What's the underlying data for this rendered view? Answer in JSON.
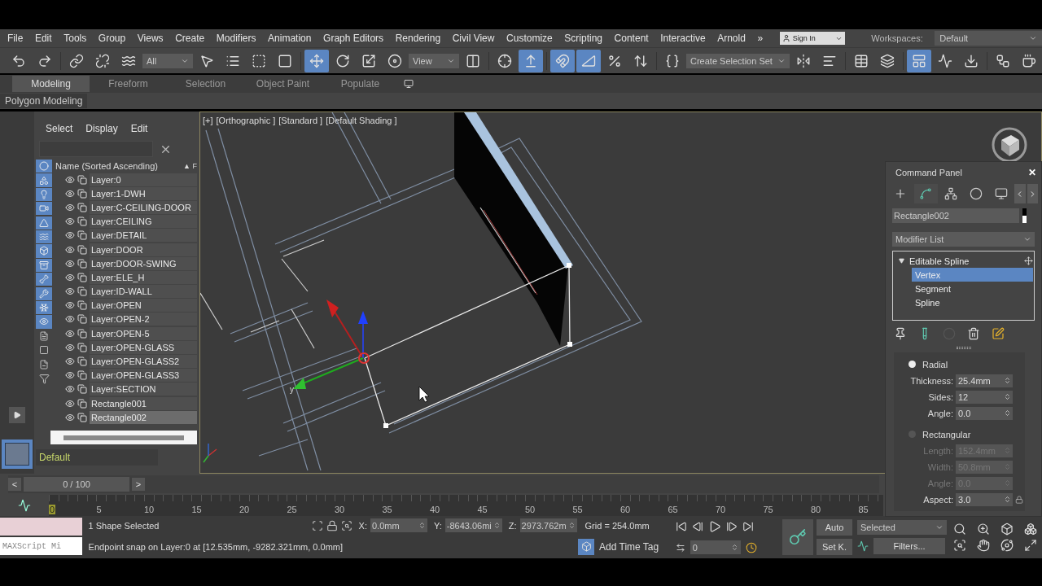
{
  "menu": [
    "File",
    "Edit",
    "Tools",
    "Group",
    "Views",
    "Create",
    "Modifiers",
    "Animation",
    "Graph Editors",
    "Rendering",
    "Civil View",
    "Customize",
    "Scripting",
    "Content",
    "Interactive",
    "Arnold"
  ],
  "menu_overflow": "»",
  "sign_in": "Sign In",
  "workspaces": {
    "label": "Workspaces:",
    "value": "Default"
  },
  "toolbar": [
    {
      "kind": "undo",
      "selected": false
    },
    {
      "kind": "redo",
      "selected": false
    },
    {
      "kind": "separator"
    },
    {
      "kind": "link",
      "selected": false
    },
    {
      "kind": "unlink",
      "selected": false
    },
    {
      "kind": "bind",
      "selected": false
    },
    {
      "kind": "dropdown",
      "label": "All"
    },
    {
      "kind": "select",
      "selected": false
    },
    {
      "kind": "select_by_name",
      "selected": false
    },
    {
      "kind": "region",
      "selected": false
    },
    {
      "kind": "window",
      "selected": false
    },
    {
      "kind": "separator"
    },
    {
      "kind": "move",
      "selected": true
    },
    {
      "kind": "rotate",
      "selected": false
    },
    {
      "kind": "scale",
      "selected": false
    },
    {
      "kind": "place",
      "selected": false
    },
    {
      "kind": "dropdown",
      "label": "View"
    },
    {
      "kind": "pivot",
      "selected": false
    },
    {
      "kind": "separator"
    },
    {
      "kind": "manipulate",
      "selected": false
    },
    {
      "kind": "shortcut",
      "selected": true
    },
    {
      "kind": "separator"
    },
    {
      "kind": "snap",
      "selected": true
    },
    {
      "kind": "angle_snap",
      "selected": true
    },
    {
      "kind": "percent",
      "selected": false
    },
    {
      "kind": "spinner",
      "selected": false
    },
    {
      "kind": "separator"
    },
    {
      "kind": "named",
      "selected": false
    },
    {
      "kind": "dropdown",
      "label": "Create Selection Set"
    },
    {
      "kind": "mirror",
      "selected": false
    },
    {
      "kind": "align",
      "selected": false
    },
    {
      "kind": "separator"
    },
    {
      "kind": "explorer",
      "selected": false
    },
    {
      "kind": "layers",
      "selected": false
    },
    {
      "kind": "separator"
    },
    {
      "kind": "ribbon",
      "selected": true
    },
    {
      "kind": "curve",
      "selected": false
    },
    {
      "kind": "download",
      "selected": false
    },
    {
      "kind": "separator"
    },
    {
      "kind": "schematic",
      "selected": false
    },
    {
      "kind": "teapot",
      "selected": false
    }
  ],
  "ribbon_tabs": [
    {
      "label": "Modeling",
      "selected": true
    },
    {
      "label": "Freeform",
      "selected": false
    },
    {
      "label": "Selection",
      "selected": false
    },
    {
      "label": "Object Paint",
      "selected": false
    },
    {
      "label": "Populate",
      "selected": false
    }
  ],
  "ribbon_panel": "Polygon Modeling",
  "scene_explorer": {
    "menu": [
      "Select",
      "Display",
      "Edit"
    ],
    "column": "Name (Sorted Ascending)",
    "sort_mark": "▲",
    "column_2": "F",
    "filters": [
      {
        "kind": "geometry",
        "on": true
      },
      {
        "kind": "shapes",
        "on": true
      },
      {
        "kind": "lights",
        "on": true
      },
      {
        "kind": "cameras",
        "on": true
      },
      {
        "kind": "helpers",
        "on": true
      },
      {
        "kind": "warps",
        "on": true
      },
      {
        "kind": "groups",
        "on": true
      },
      {
        "kind": "xrefs",
        "on": true
      },
      {
        "kind": "bones",
        "on": true
      },
      {
        "kind": "containers",
        "on": true
      },
      {
        "kind": "frozen",
        "on": true
      },
      {
        "kind": "hidden",
        "on": true
      },
      {
        "kind": "all",
        "on": false
      },
      {
        "kind": "none",
        "on": false
      },
      {
        "kind": "invert",
        "on": false
      }
    ],
    "rows": [
      {
        "name": "Layer:0",
        "selected": false
      },
      {
        "name": "Layer:1-DWH",
        "selected": false
      },
      {
        "name": "Layer:C-CEILING-DOOR",
        "selected": false
      },
      {
        "name": "Layer:CEILING",
        "selected": false
      },
      {
        "name": "Layer:DETAIL",
        "selected": false
      },
      {
        "name": "Layer:DOOR",
        "selected": false
      },
      {
        "name": "Layer:DOOR-SWING",
        "selected": false
      },
      {
        "name": "Layer:ELE_H",
        "selected": false
      },
      {
        "name": "Layer:ID-WALL",
        "selected": false
      },
      {
        "name": "Layer:OPEN",
        "selected": false
      },
      {
        "name": "Layer:OPEN-2",
        "selected": false
      },
      {
        "name": "Layer:OPEN-5",
        "selected": false
      },
      {
        "name": "Layer:OPEN-GLASS",
        "selected": false
      },
      {
        "name": "Layer:OPEN-GLASS2",
        "selected": false
      },
      {
        "name": "Layer:OPEN-GLASS3",
        "selected": false
      },
      {
        "name": "Layer:SECTION",
        "selected": false
      },
      {
        "name": "Rectangle001",
        "selected": false
      },
      {
        "name": "Rectangle002",
        "selected": true
      }
    ],
    "workspace": "Default"
  },
  "viewport": {
    "labels": [
      "[+]",
      "[Orthographic ]",
      "[Standard ]",
      "[Default Shading ]"
    ],
    "gizmo_label": "y"
  },
  "command_panel": {
    "title": "Command Panel",
    "close": "✕",
    "tabs": [
      {
        "kind": "create",
        "selected": false
      },
      {
        "kind": "modify",
        "selected": true
      },
      {
        "kind": "hierarchy",
        "selected": false
      },
      {
        "kind": "motion",
        "selected": false
      },
      {
        "kind": "display",
        "selected": false
      }
    ],
    "object_name": "Rectangle002",
    "modifier_list": "Modifier List",
    "modifier_stack": {
      "name": "Editable Spline",
      "expanded": true,
      "children": [
        {
          "name": "Vertex",
          "selected": true
        },
        {
          "name": "Segment",
          "selected": false
        },
        {
          "name": "Spline",
          "selected": false
        }
      ]
    },
    "radial": {
      "label": "Radial",
      "selected": true
    },
    "radial_fields": [
      {
        "label": "Thickness:",
        "value": "25.4mm",
        "disabled": false
      },
      {
        "label": "Sides:",
        "value": "12",
        "disabled": false
      },
      {
        "label": "Angle:",
        "value": "0.0",
        "disabled": false
      }
    ],
    "rectangular": {
      "label": "Rectangular",
      "selected": false
    },
    "rectangular_fields": [
      {
        "label": "Length:",
        "value": "152.4mm",
        "disabled": true
      },
      {
        "label": "Width:",
        "value": "50.8mm",
        "disabled": true
      },
      {
        "label": "Angle:",
        "value": "0.0",
        "disabled": true
      },
      {
        "label": "Aspect:",
        "value": "3.0",
        "disabled": false
      }
    ]
  },
  "time_slider": {
    "prev": "<",
    "frame": "0 / 100",
    "next": ">",
    "level": 0
  },
  "timeline_ticks": [
    "0",
    "5",
    "10",
    "15",
    "20",
    "25",
    "30",
    "35",
    "40",
    "45",
    "50",
    "55",
    "60",
    "65",
    "70",
    "75",
    "80",
    "85"
  ],
  "status": {
    "maxscript": "MAXScript Mi",
    "selection": "1 Shape Selected",
    "prompt": "Endpoint snap on Layer:0 at [12.535mm, -9282.321mm, 0.0mm]",
    "coords": [
      {
        "label": "X:",
        "value": "0.0mm"
      },
      {
        "label": "Y:",
        "value": "-8643.06mi"
      },
      {
        "label": "Z:",
        "value": "2973.762m"
      }
    ],
    "grid": "Grid = 254.0mm",
    "time_tag": "Add Time Tag",
    "frame": "0",
    "auto": "Auto",
    "set_key": "Set K.",
    "key_filter": "Selected",
    "filters": "Filters..."
  }
}
